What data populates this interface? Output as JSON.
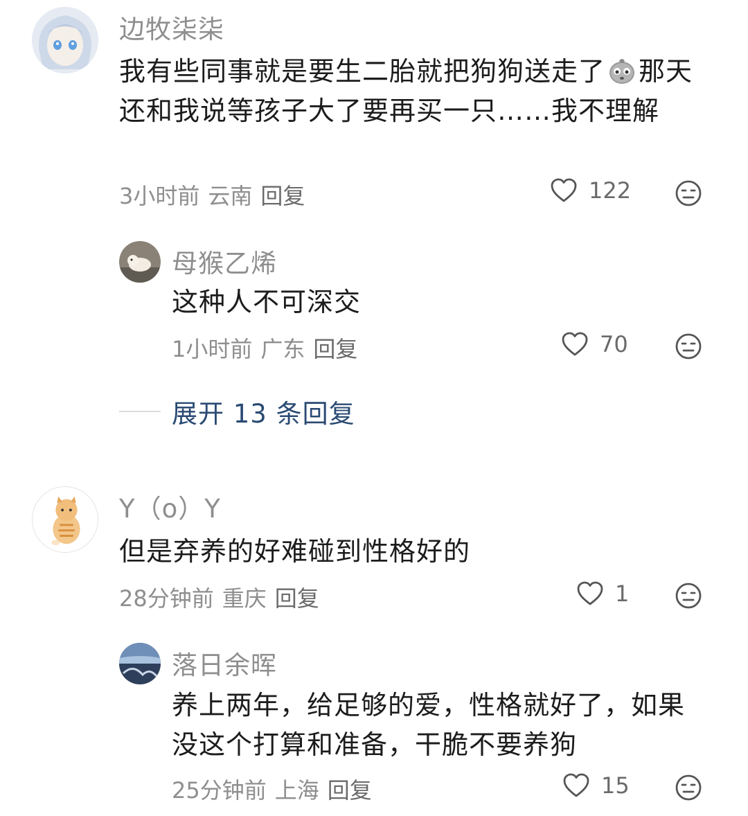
{
  "comments": [
    {
      "username": "边牧柒柒",
      "text_before_emoji": "我有些同事就是要生二胎就把狗狗送走了",
      "emoji_icon": "crying-face-emoji",
      "text_after_emoji": "那天还和我说等孩子大了要再买一只……我不理解",
      "time": "3小时前",
      "location": "云南",
      "reply": "回复",
      "likes": "122",
      "replies": [
        {
          "username": "母猴乙烯",
          "text": "这种人不可深交",
          "time": "1小时前",
          "location": "广东",
          "reply": "回复",
          "likes": "70"
        }
      ],
      "expand_label": "展开 13 条回复"
    },
    {
      "username": "Y（o）Y",
      "text": "但是弃养的好难碰到性格好的",
      "time": "28分钟前",
      "location": "重庆",
      "reply": "回复",
      "likes": "1",
      "replies": [
        {
          "username": "落日余晖",
          "text": "养上两年，给足够的爱，性格就好了，如果没这个打算和准备，干脆不要养狗",
          "time": "25分钟前",
          "location": "上海",
          "reply": "回复",
          "likes": "15"
        }
      ]
    }
  ],
  "icons": {
    "like": "heart-outline-icon",
    "dislike": "neutral-face-icon"
  },
  "colors": {
    "username": "#8e8e8e",
    "text": "#1c1c1c",
    "expand_link": "#2a4a73",
    "meta": "#8e8e8e"
  }
}
